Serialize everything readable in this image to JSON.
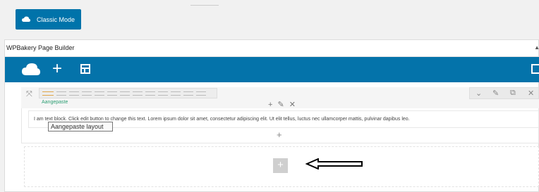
{
  "classic_mode_button": {
    "label": "Classic Mode",
    "icon": "wpbakery-cloud-icon"
  },
  "panel": {
    "title": "WPBakery Page Builder",
    "toolbar": {
      "brand_color": "#0473aa",
      "icons": [
        "wpbakery-cloud-icon",
        "add-element-icon",
        "templates-icon",
        "fullscreen-icon"
      ]
    }
  },
  "row": {
    "layout_label": "Aangepaste",
    "column_controls": "+ ✎ ✕",
    "row_controls": [
      "⌄",
      "✎",
      "⧉",
      "✕"
    ],
    "text": "I am text block. Click edit button to change this text. Lorem ipsum dolor sit amet, consectetur adipiscing elit. Ut elit tellus, luctus nec ullamcorper mattis, pulvinar dapibus leo.",
    "tooltip": "Aangepaste layout",
    "add_column": "+"
  },
  "empty_row": {
    "add_element": "+"
  }
}
